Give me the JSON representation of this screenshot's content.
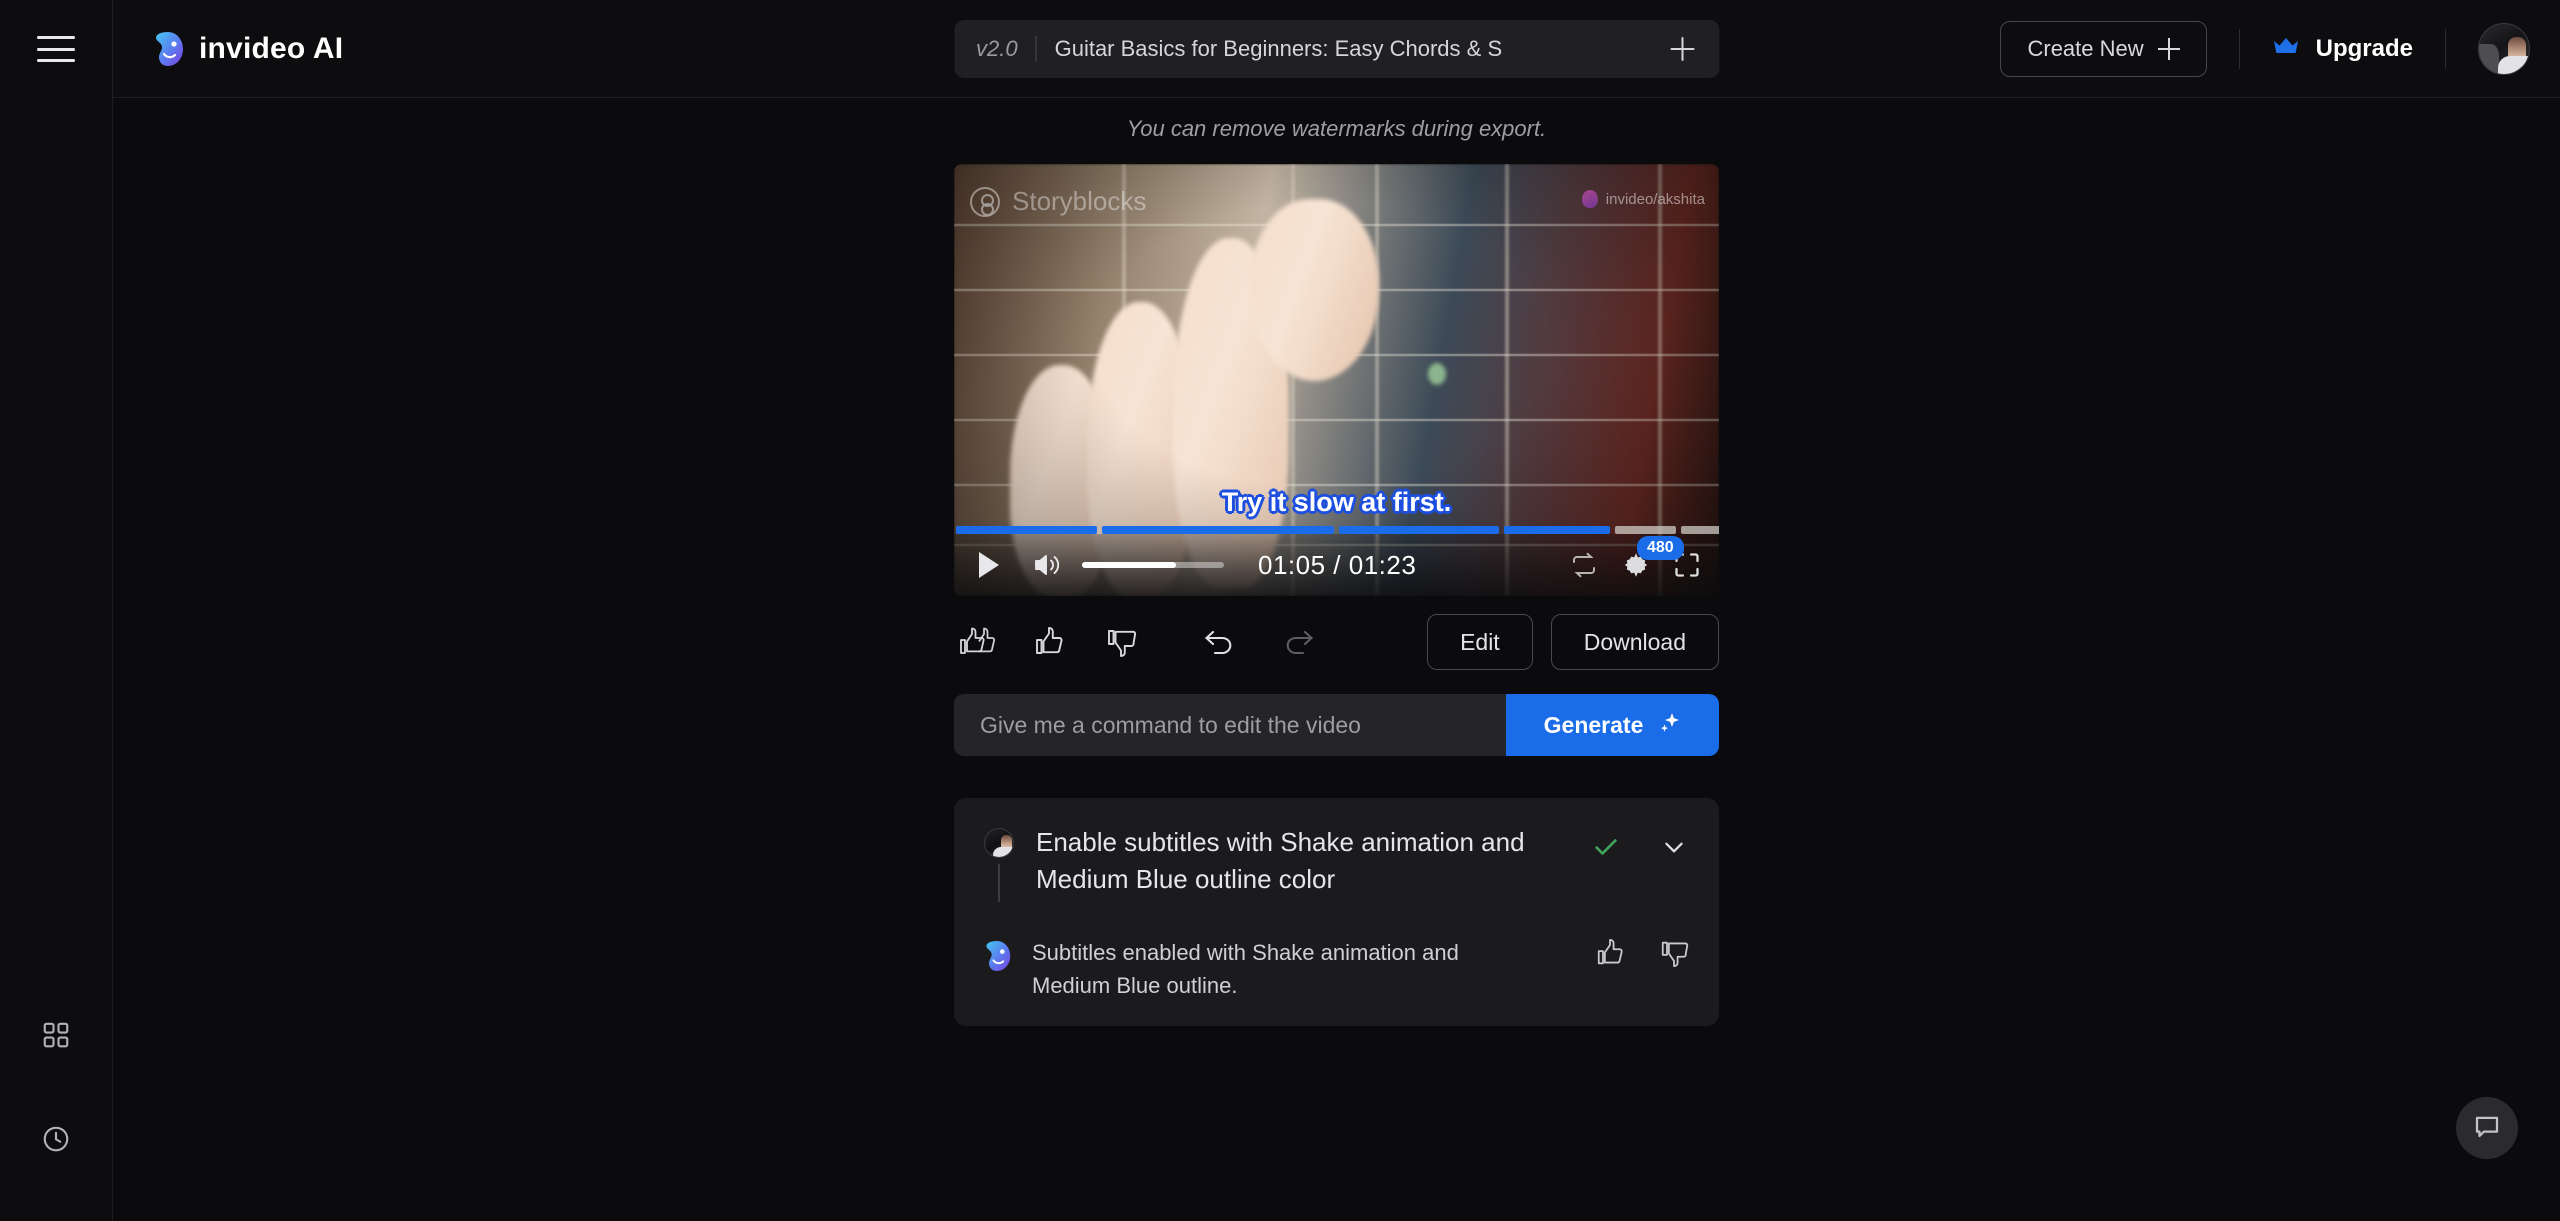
{
  "theme": {
    "accent": "#1a6ce8",
    "bg": "#0b0b0d",
    "panel": "#1b1b1e",
    "subtitle_outline": "#1c4fe0",
    "check_green": "#3fa35a"
  },
  "rail": {
    "menu_icon": "hamburger-menu-icon",
    "items": [
      {
        "icon": "grid-dashboard-icon",
        "label": "Dashboard"
      },
      {
        "icon": "clock-history-icon",
        "label": "History"
      }
    ]
  },
  "header": {
    "brand_name": "invideo AI",
    "brand_icon": "invideo-logo-icon",
    "version": "v2.0",
    "project_title": "Guitar Basics for Beginners: Easy Chords & S",
    "new_tab_icon": "plus-icon",
    "create_new_label": "Create New",
    "create_new_icon": "plus-icon",
    "upgrade_label": "Upgrade",
    "upgrade_icon": "crown-icon",
    "avatar_icon": "user-avatar"
  },
  "main": {
    "watermark_note": "You can remove watermarks during export."
  },
  "player": {
    "watermark_left": "Storyblocks",
    "watermark_right": "invideo/akshita",
    "subtitle_text": "Try it slow at first.",
    "play_icon": "play-icon",
    "volume_icon": "volume-high-icon",
    "volume_percent": 66,
    "current_time": "01:05",
    "total_time": "01:23",
    "time_display": "01:05 / 01:23",
    "loop_icon": "loop-icon",
    "settings_icon": "gear-icon",
    "quality_badge": "480",
    "fullscreen_icon": "fullscreen-icon",
    "progress_percent": 78,
    "segments": [
      {
        "width": 18.5,
        "played": true
      },
      {
        "width": 30.5,
        "played": true
      },
      {
        "width": 21.0,
        "played": true
      },
      {
        "width": 14.0,
        "played": true
      },
      {
        "width": 8.0,
        "played": false
      },
      {
        "width": 8.0,
        "played": false
      }
    ]
  },
  "actions": {
    "double_like_icon": "double-thumbs-up-icon",
    "like_icon": "thumbs-up-icon",
    "dislike_icon": "thumbs-down-icon",
    "undo_icon": "undo-icon",
    "redo_icon": "redo-icon",
    "edit_label": "Edit",
    "download_label": "Download"
  },
  "command": {
    "placeholder": "Give me a command to edit the video",
    "value": "",
    "generate_label": "Generate",
    "generate_icon": "sparkle-icon"
  },
  "chat": {
    "user_message": "Enable subtitles with Shake animation and Medium Blue outline color",
    "user_avatar_icon": "user-avatar",
    "status_icon": "check-icon",
    "expand_icon": "chevron-down-icon",
    "ai_avatar_icon": "invideo-logo-icon",
    "ai_message": "Subtitles enabled with Shake animation and Medium Blue outline.",
    "ai_like_icon": "thumbs-up-icon",
    "ai_dislike_icon": "thumbs-down-icon"
  },
  "support": {
    "icon": "chat-bubble-icon",
    "label": "Support chat"
  }
}
